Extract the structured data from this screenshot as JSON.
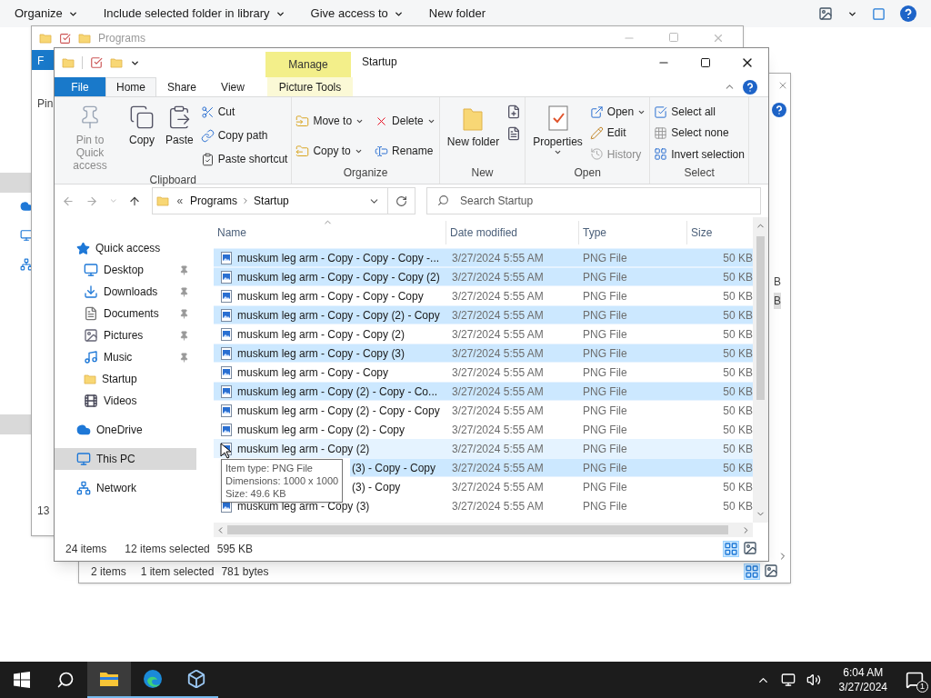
{
  "desktop_toolbar": [
    {
      "label": "Organize",
      "dropdown": true
    },
    {
      "label": "Include selected folder in library",
      "dropdown": true
    },
    {
      "label": "Give access to",
      "dropdown": true
    },
    {
      "label": "New folder",
      "dropdown": false
    }
  ],
  "back_window": {
    "title": "Programs",
    "tab": "F",
    "button": "Pin",
    "status": "13"
  },
  "middle_window": {
    "cells": [
      "B",
      "B"
    ],
    "status": [
      "2 items",
      "1 item selected",
      "781 bytes"
    ]
  },
  "window": {
    "title": "Startup",
    "context_tab": "Manage",
    "tabs": [
      {
        "label": "File",
        "kind": "file",
        "selected": false
      },
      {
        "label": "Home",
        "kind": "tab",
        "selected": true
      },
      {
        "label": "Share",
        "kind": "tab",
        "selected": false
      },
      {
        "label": "View",
        "kind": "tab",
        "selected": false
      },
      {
        "label": "Picture Tools",
        "kind": "context",
        "selected": false
      }
    ],
    "ribbon": [
      {
        "label": "Clipboard",
        "buttons": [
          {
            "label": "Pin to Quick access",
            "kind": "large",
            "disabled": true,
            "dropdown": false
          },
          {
            "label": "Copy",
            "kind": "large",
            "disabled": false,
            "dropdown": false
          },
          {
            "label": "Paste",
            "kind": "large",
            "disabled": false,
            "dropdown": false
          },
          {
            "label": "Cut",
            "kind": "small",
            "disabled": false,
            "dropdown": false
          },
          {
            "label": "Copy path",
            "kind": "small",
            "disabled": false,
            "dropdown": false
          },
          {
            "label": "Paste shortcut",
            "kind": "small",
            "disabled": false,
            "dropdown": false
          }
        ]
      },
      {
        "label": "Organize",
        "buttons": [
          {
            "label": "Move to",
            "kind": "small",
            "disabled": false,
            "dropdown": true
          },
          {
            "label": "Copy to",
            "kind": "small",
            "disabled": false,
            "dropdown": true
          },
          {
            "label": "Delete",
            "kind": "small",
            "disabled": false,
            "dropdown": true
          },
          {
            "label": "Rename",
            "kind": "small",
            "disabled": false,
            "dropdown": false
          }
        ]
      },
      {
        "label": "New",
        "buttons": [
          {
            "label": "New folder",
            "kind": "large",
            "disabled": false,
            "dropdown": false
          }
        ]
      },
      {
        "label": "Open",
        "buttons": [
          {
            "label": "Properties",
            "kind": "large",
            "disabled": false,
            "dropdown": true
          },
          {
            "label": "Open",
            "kind": "small",
            "disabled": false,
            "dropdown": true
          },
          {
            "label": "Edit",
            "kind": "small",
            "disabled": false,
            "dropdown": false
          },
          {
            "label": "History",
            "kind": "small",
            "disabled": true,
            "dropdown": false
          }
        ]
      },
      {
        "label": "Select",
        "buttons": [
          {
            "label": "Select all",
            "kind": "small",
            "disabled": false,
            "dropdown": false
          },
          {
            "label": "Select none",
            "kind": "small",
            "disabled": false,
            "dropdown": false
          },
          {
            "label": "Invert selection",
            "kind": "small",
            "disabled": false,
            "dropdown": false
          }
        ]
      }
    ],
    "address": {
      "prefix": "«",
      "path": [
        "Programs",
        "Startup"
      ]
    },
    "search": {
      "placeholder": "Search Startup"
    },
    "nav": [
      {
        "label": "Quick access",
        "selected": false,
        "children": [
          {
            "label": "Desktop",
            "pinned": true,
            "selected": false
          },
          {
            "label": "Downloads",
            "pinned": true,
            "selected": false
          },
          {
            "label": "Documents",
            "pinned": true,
            "selected": false
          },
          {
            "label": "Pictures",
            "pinned": true,
            "selected": false
          },
          {
            "label": "Music",
            "pinned": true,
            "selected": false
          },
          {
            "label": "Startup",
            "pinned": false,
            "selected": false
          },
          {
            "label": "Videos",
            "pinned": false,
            "selected": false
          }
        ]
      },
      {
        "label": "OneDrive",
        "selected": false
      },
      {
        "label": "This PC",
        "selected": true
      },
      {
        "label": "Network",
        "selected": false
      }
    ],
    "columns": [
      "Name",
      "Date modified",
      "Type",
      "Size"
    ],
    "rows": [
      {
        "name": "muskum leg arm - Copy - Copy - Copy -...",
        "date": "3/27/2024 5:55 AM",
        "type": "PNG File",
        "size": "50 KB",
        "selected": true,
        "hovered": false,
        "kind": "file"
      },
      {
        "name": "muskum leg arm - Copy - Copy - Copy (2)",
        "date": "3/27/2024 5:55 AM",
        "type": "PNG File",
        "size": "50 KB",
        "selected": true,
        "hovered": false,
        "kind": "file"
      },
      {
        "name": "muskum leg arm - Copy - Copy - Copy",
        "date": "3/27/2024 5:55 AM",
        "type": "PNG File",
        "size": "50 KB",
        "selected": false,
        "hovered": false,
        "kind": "file"
      },
      {
        "name": "muskum leg arm - Copy - Copy (2) - Copy",
        "date": "3/27/2024 5:55 AM",
        "type": "PNG File",
        "size": "50 KB",
        "selected": true,
        "hovered": false,
        "kind": "file"
      },
      {
        "name": "muskum leg arm - Copy - Copy (2)",
        "date": "3/27/2024 5:55 AM",
        "type": "PNG File",
        "size": "50 KB",
        "selected": false,
        "hovered": false,
        "kind": "file"
      },
      {
        "name": "muskum leg arm - Copy - Copy (3)",
        "date": "3/27/2024 5:55 AM",
        "type": "PNG File",
        "size": "50 KB",
        "selected": true,
        "hovered": false,
        "kind": "file"
      },
      {
        "name": "muskum leg arm - Copy - Copy",
        "date": "3/27/2024 5:55 AM",
        "type": "PNG File",
        "size": "50 KB",
        "selected": false,
        "hovered": false,
        "kind": "file"
      },
      {
        "name": "muskum leg arm - Copy (2) - Copy - Co...",
        "date": "3/27/2024 5:55 AM",
        "type": "PNG File",
        "size": "50 KB",
        "selected": true,
        "hovered": false,
        "kind": "file"
      },
      {
        "name": "muskum leg arm - Copy (2) - Copy - Copy",
        "date": "3/27/2024 5:55 AM",
        "type": "PNG File",
        "size": "50 KB",
        "selected": false,
        "hovered": false,
        "kind": "file"
      },
      {
        "name": "muskum leg arm - Copy (2) - Copy",
        "date": "3/27/2024 5:55 AM",
        "type": "PNG File",
        "size": "50 KB",
        "selected": false,
        "hovered": false,
        "kind": "file"
      },
      {
        "name": "muskum leg arm - Copy (2)",
        "date": "3/27/2024 5:55 AM",
        "type": "PNG File",
        "size": "50 KB",
        "selected": false,
        "hovered": true,
        "kind": "file"
      },
      {
        "name": "(3) - Copy - Copy",
        "date": "3/27/2024 5:55 AM",
        "type": "PNG File",
        "size": "50 KB",
        "selected": true,
        "hovered": false,
        "kind": "covered"
      },
      {
        "name": "(3) - Copy",
        "date": "3/27/2024 5:55 AM",
        "type": "PNG File",
        "size": "50 KB",
        "selected": false,
        "hovered": false,
        "kind": "covered"
      },
      {
        "name": "muskum leg arm - Copy (3)",
        "date": "3/27/2024 5:55 AM",
        "type": "PNG File",
        "size": "50 KB",
        "selected": false,
        "hovered": false,
        "kind": "file"
      }
    ],
    "tooltip": [
      "Item type: PNG File",
      "Dimensions: 1000 x 1000",
      "Size: 49.6 KB"
    ],
    "status": [
      "24 items",
      "12 items selected",
      "595 KB"
    ]
  },
  "taskbar": {
    "apps": [
      {
        "kind": "explorer",
        "active": true
      },
      {
        "kind": "edge",
        "active": false
      },
      {
        "kind": "cube",
        "active": false
      }
    ],
    "time": "6:04 AM",
    "date": "3/27/2024",
    "notifications": "1"
  }
}
